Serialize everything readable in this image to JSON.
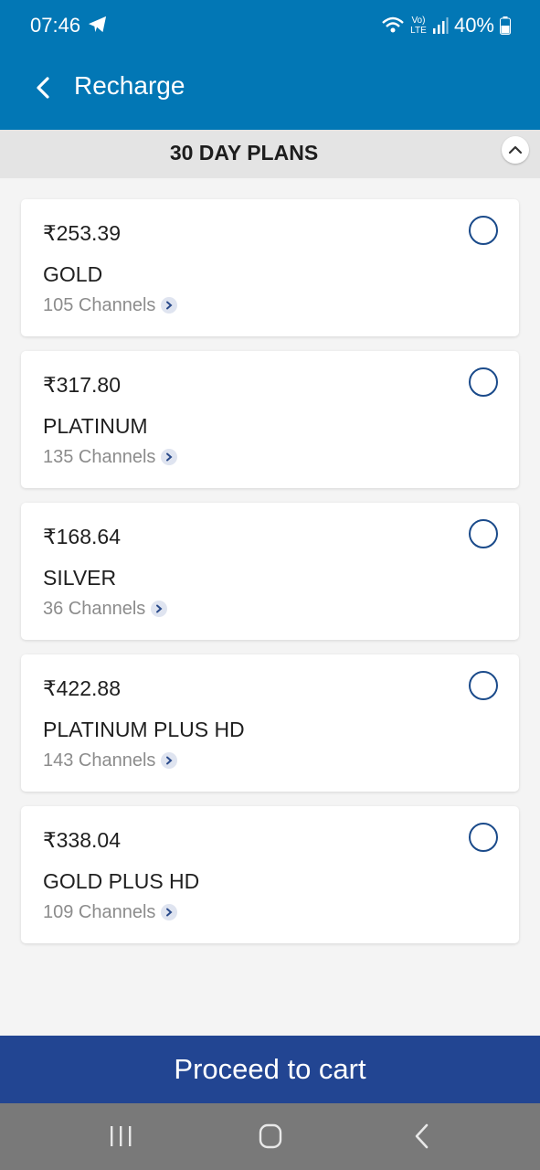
{
  "status_bar": {
    "time": "07:46",
    "battery": "40%",
    "network": "Vo) LTE"
  },
  "app_bar": {
    "title": "Recharge"
  },
  "section": {
    "title": "30 DAY PLANS"
  },
  "plans": [
    {
      "price": "₹253.39",
      "name": "GOLD",
      "channels": "105 Channels",
      "selected": false
    },
    {
      "price": "₹317.80",
      "name": "PLATINUM",
      "channels": "135 Channels",
      "selected": false
    },
    {
      "price": "₹168.64",
      "name": "SILVER",
      "channels": "36 Channels",
      "selected": false
    },
    {
      "price": "₹422.88",
      "name": "PLATINUM PLUS HD",
      "channels": "143 Channels",
      "selected": false
    },
    {
      "price": "₹338.04",
      "name": "GOLD PLUS HD",
      "channels": "109 Channels",
      "selected": false
    }
  ],
  "footer": {
    "proceed_label": "Proceed to cart"
  },
  "colors": {
    "primary": "#0277b5",
    "button": "#224592",
    "radio_border": "#1a4a8a"
  },
  "icons": [
    "telegram-icon",
    "wifi-icon",
    "signal-icon",
    "battery-icon",
    "back-arrow-icon",
    "chevron-up-icon",
    "chevron-right-icon",
    "recents-icon",
    "home-icon",
    "back-nav-icon"
  ]
}
